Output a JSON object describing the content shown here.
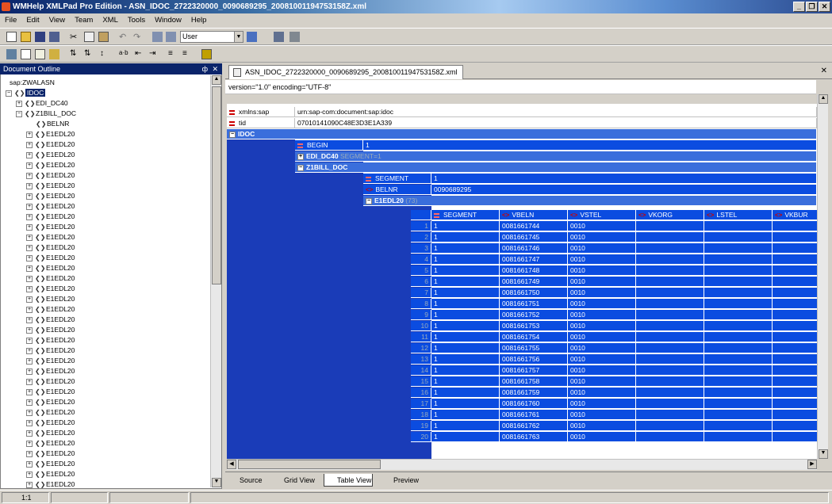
{
  "window": {
    "title": "WMHelp XMLPad Pro Edition - ASN_IDOC_2722320000_0090689295_20081001194753158Z.xml"
  },
  "menu": [
    "File",
    "Edit",
    "View",
    "Team",
    "XML",
    "Tools",
    "Window",
    "Help"
  ],
  "toolbar": {
    "user_select": "User"
  },
  "outline": {
    "title": "Document Outline",
    "root": "sap:ZWALASN",
    "idoc": "IDOC",
    "edi": "EDI_DC40",
    "bill": "Z1BILL_DOC",
    "belnr": "BELNR",
    "item": "E1EDL20"
  },
  "editor": {
    "tab": "ASN_IDOC_2722320000_0090689295_20081001194753158Z.xml",
    "declaration": "version=\"1.0\" encoding=\"UTF-8\"",
    "xmlns_label": "xmlns:sap",
    "xmlns_value": "urn:sap-com:document:sap:idoc",
    "tid_label": "tid",
    "tid_value": "07010141090C48E3D3E1A339",
    "idoc_label": "IDOC",
    "begin_label": "BEGIN",
    "begin_value": "1",
    "edi_label": "EDI_DC40",
    "edi_meta": "SEGMENT=1",
    "bill_label": "Z1BILL_DOC",
    "segment_label": "SEGMENT",
    "segment_value": "1",
    "belnr_label": "BELNR",
    "belnr_value": "0090689295",
    "item_label": "E1EDL20",
    "item_count": "(73)",
    "columns": [
      "SEGMENT",
      "VBELN",
      "VSTEL",
      "VKORG",
      "LSTEL",
      "VKBUR"
    ],
    "rows": [
      {
        "n": "1",
        "seg": "1",
        "vbeln": "0081661744",
        "vstel": "0010"
      },
      {
        "n": "2",
        "seg": "1",
        "vbeln": "0081661745",
        "vstel": "0010"
      },
      {
        "n": "3",
        "seg": "1",
        "vbeln": "0081661746",
        "vstel": "0010"
      },
      {
        "n": "4",
        "seg": "1",
        "vbeln": "0081661747",
        "vstel": "0010"
      },
      {
        "n": "5",
        "seg": "1",
        "vbeln": "0081661748",
        "vstel": "0010"
      },
      {
        "n": "6",
        "seg": "1",
        "vbeln": "0081661749",
        "vstel": "0010"
      },
      {
        "n": "7",
        "seg": "1",
        "vbeln": "0081661750",
        "vstel": "0010"
      },
      {
        "n": "8",
        "seg": "1",
        "vbeln": "0081661751",
        "vstel": "0010"
      },
      {
        "n": "9",
        "seg": "1",
        "vbeln": "0081661752",
        "vstel": "0010"
      },
      {
        "n": "10",
        "seg": "1",
        "vbeln": "0081661753",
        "vstel": "0010"
      },
      {
        "n": "11",
        "seg": "1",
        "vbeln": "0081661754",
        "vstel": "0010"
      },
      {
        "n": "12",
        "seg": "1",
        "vbeln": "0081661755",
        "vstel": "0010"
      },
      {
        "n": "13",
        "seg": "1",
        "vbeln": "0081661756",
        "vstel": "0010"
      },
      {
        "n": "14",
        "seg": "1",
        "vbeln": "0081661757",
        "vstel": "0010"
      },
      {
        "n": "15",
        "seg": "1",
        "vbeln": "0081661758",
        "vstel": "0010"
      },
      {
        "n": "16",
        "seg": "1",
        "vbeln": "0081661759",
        "vstel": "0010"
      },
      {
        "n": "17",
        "seg": "1",
        "vbeln": "0081661760",
        "vstel": "0010"
      },
      {
        "n": "18",
        "seg": "1",
        "vbeln": "0081661761",
        "vstel": "0010"
      },
      {
        "n": "19",
        "seg": "1",
        "vbeln": "0081661762",
        "vstel": "0010"
      },
      {
        "n": "20",
        "seg": "1",
        "vbeln": "0081661763",
        "vstel": "0010"
      }
    ]
  },
  "bottom_tabs": [
    "Source",
    "Grid View",
    "Table View",
    "Preview"
  ],
  "status": {
    "position": "1:1"
  }
}
